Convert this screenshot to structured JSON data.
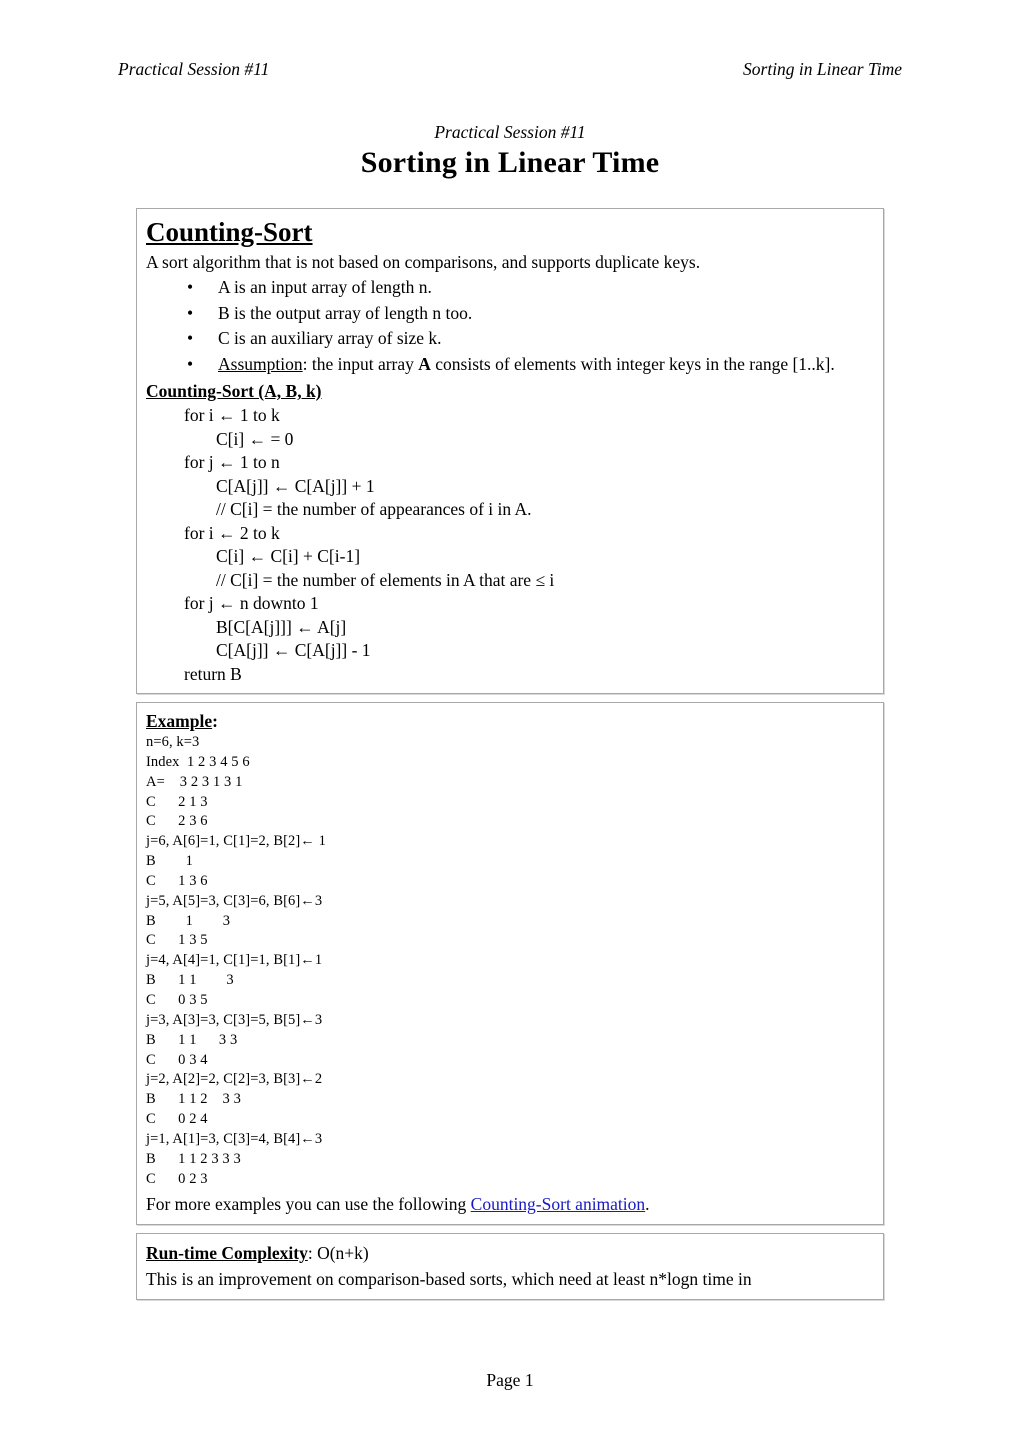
{
  "running_header": {
    "left": "Practical Session #11",
    "right": "Sorting in Linear Time"
  },
  "title": {
    "subtitle": "Practical Session #11",
    "main": "Sorting in Linear Time"
  },
  "counting_sort_box": {
    "heading": "Counting-Sort",
    "intro": "A sort algorithm that is not based on comparisons, and supports duplicate keys.",
    "bullets": [
      {
        "bullet": "•",
        "text": "A is an input array of length n."
      },
      {
        "bullet": "•",
        "text": "B is the output array of length n too."
      },
      {
        "bullet": "•",
        "text": "C is an auxiliary array of size k."
      }
    ],
    "assumption": {
      "bullet": "•",
      "label": "Assumption",
      "text_before": ": the input array ",
      "bold_token": "A",
      "text_after": " consists of elements with integer keys in the range [1..k]."
    },
    "pseudocode_title": "Counting-Sort (A, B, k)",
    "pseudocode": [
      {
        "indent": 1,
        "text": "for i ← 1 to k"
      },
      {
        "indent": 2,
        "text": "C[i] ← = 0"
      },
      {
        "indent": 1,
        "text": "for j ← 1 to n"
      },
      {
        "indent": 2,
        "text": "C[A[j]] ← C[A[j]] + 1"
      },
      {
        "indent": 2,
        "text": "// C[i] = the number of appearances of i in A."
      },
      {
        "indent": 1,
        "text": "for i ← 2 to k"
      },
      {
        "indent": 2,
        "text": "C[i] ← C[i] + C[i-1]"
      },
      {
        "indent": 2,
        "text": "// C[i] = the number of elements in A that are ≤ i"
      },
      {
        "indent": 1,
        "text": "for j ← n downto 1"
      },
      {
        "indent": 2,
        "text": "B[C[A[j]]] ← A[j]"
      },
      {
        "indent": 2,
        "text": "C[A[j]] ← C[A[j]] - 1"
      },
      {
        "indent": 1,
        "text": "return B"
      }
    ]
  },
  "example_box": {
    "heading_label": "Example",
    "heading_colon": ":",
    "lines": [
      "n=6, k=3",
      "Index  1 2 3 4 5 6",
      "A=    3 2 3 1 3 1",
      "C      2 1 3",
      "C      2 3 6",
      "j=6, A[6]=1, C[1]=2, B[2]← 1",
      "B        1",
      "C      1 3 6",
      "j=5, A[5]=3, C[3]=6, B[6]←3",
      "B        1        3",
      "C      1 3 5",
      "j=4, A[4]=1, C[1]=1, B[1]←1",
      "B      1 1        3",
      "C      0 3 5",
      "j=3, A[3]=3, C[3]=5, B[5]←3",
      "B      1 1      3 3",
      "C      0 3 4",
      "j=2, A[2]=2, C[2]=3, B[3]←2",
      "B      1 1 2    3 3",
      "C      0 2 4",
      "j=1, A[1]=3, C[3]=4, B[4]←3",
      "B      1 1 2 3 3 3",
      "C      0 2 3"
    ],
    "footer_before": "For more examples you can use the following ",
    "footer_link": "Counting-Sort animation",
    "footer_after": "."
  },
  "complexity_box": {
    "label": "Run-time Complexity",
    "value": ": O(n+k)",
    "note": "This is an improvement on comparison-based sorts, which need at least n*logn time in"
  },
  "footer": {
    "page": "Page 1"
  }
}
